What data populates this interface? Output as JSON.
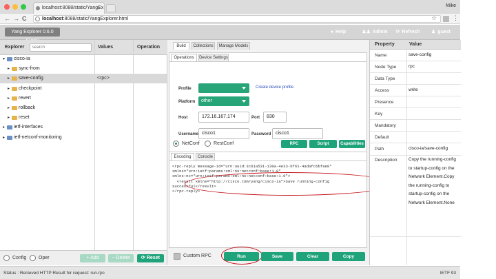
{
  "browser": {
    "tab_title": "localhost:8088/static/YangEx",
    "tab_close": "×",
    "profile": "Mike",
    "url_bold": "localhost",
    "url_rest": ":8088/static/YangExplorer.html",
    "back_glyph": "←",
    "forward_glyph": "→",
    "reload_glyph": "C",
    "star_glyph": "☆",
    "menu_glyph": "⋮"
  },
  "header": {
    "title": "Yang Explorer 0.6.0 (Beta)",
    "buttons": [
      {
        "label": "Help",
        "icon": "github-icon",
        "glyph": "●",
        "color": "#2f8fd8"
      },
      {
        "label": "Admin",
        "icon": "users-icon",
        "glyph": "♟♟",
        "color": "#2f8fd8"
      },
      {
        "label": "Refresh",
        "icon": "refresh-icon",
        "glyph": "⟳",
        "color": "#2f8fd8"
      },
      {
        "label": "guest",
        "icon": "user-icon",
        "glyph": "♟",
        "color": "#1fa37a"
      }
    ]
  },
  "explorer": {
    "col_explorer": "Explorer",
    "search_placeholder": "search",
    "col_values": "Values",
    "col_operation": "Operation",
    "rows": [
      {
        "label": "cisco-ia",
        "type": "module",
        "level": 0,
        "expanded": true,
        "value": ""
      },
      {
        "label": "sync-from",
        "type": "folder",
        "level": 1,
        "expanded": false,
        "value": ""
      },
      {
        "label": "save-config",
        "type": "folder",
        "level": 1,
        "expanded": false,
        "value": "<rpc>",
        "selected": true
      },
      {
        "label": "checkpoint",
        "type": "folder",
        "level": 1,
        "expanded": false,
        "value": ""
      },
      {
        "label": "revert",
        "type": "folder",
        "level": 1,
        "expanded": false,
        "value": ""
      },
      {
        "label": "rollback",
        "type": "folder",
        "level": 1,
        "expanded": false,
        "value": ""
      },
      {
        "label": "reset",
        "type": "folder",
        "level": 1,
        "expanded": false,
        "value": ""
      },
      {
        "label": "ietf-interfaces",
        "type": "module",
        "level": 0,
        "expanded": false,
        "value": ""
      },
      {
        "label": "ietf-netconf-monitoring",
        "type": "module",
        "level": 0,
        "expanded": false,
        "value": ""
      }
    ],
    "footer": {
      "config_label": "Config",
      "oper_label": "Oper",
      "add_label": "+ Add",
      "delete_label": "− Delete",
      "reset_label": "⟳ Reset"
    }
  },
  "middle": {
    "tabs": [
      "Build",
      "Collections",
      "Manage Models"
    ],
    "active_tab": 0,
    "subtabs": [
      "Operations",
      "Device Settings"
    ],
    "form": {
      "profile_label": "Profile",
      "profile_value": "",
      "create_profile_link": "Create device profile",
      "platform_label": "Platform",
      "platform_value": "other",
      "host_label": "Host",
      "host_value": "172.16.167.174",
      "port_label": "Port",
      "port_value": "830",
      "username_label": "Username",
      "username_value": "cisco1",
      "password_label": "Password",
      "password_value": "cisco1",
      "netconf_label": "NetConf",
      "restconf_label": "RestConf",
      "rpc_button": "RPC",
      "script_button": "Script",
      "capabilities_button": "Capabilities"
    },
    "encoding_tabs": [
      "Encoding",
      "Console"
    ],
    "rpc_output": "<rpc-reply message-id=\"urn:uuid:3c61a531-130a-4e33-bf61-4adafc6bfae8\"\nxmlns=\"urn:ietf:params:xml:ns:netconf:base:1.0\"\nxmlns:nc=\"urn:ietf:params:xml:ns:netconf:base:1.0\">\n  <result xmlns=\"http://cisco.com/yang/cisco-ia\">Save running-config\nsuccessful</result>\n</rpc-reply>",
    "footer": {
      "custom_rpc": "Custom RPC",
      "run": "Run",
      "save": "Save",
      "clear": "Clear",
      "copy": "Copy"
    }
  },
  "properties": {
    "col_property": "Property",
    "col_value": "Value",
    "rows": [
      {
        "key": "Name",
        "value": "save-config"
      },
      {
        "key": "Node Type",
        "value": "rpc"
      },
      {
        "key": "Data Type",
        "value": ""
      },
      {
        "key": "Access",
        "value": "write"
      },
      {
        "key": "Presence",
        "value": ""
      },
      {
        "key": "Key",
        "value": ""
      },
      {
        "key": "Mandatory",
        "value": ""
      },
      {
        "key": "Default",
        "value": ""
      },
      {
        "key": "Path",
        "value": "cisco-ia/save-config"
      },
      {
        "key": "Description",
        "value": "Copy the running-config to startup-config on the Network Element.Copy the running-config to startup-config on the Network Element.None"
      }
    ]
  },
  "status": {
    "text": "Status : Recieved HTTP Result for request: run-rpc",
    "ietf": "IETF 93"
  },
  "colors": {
    "green": "#1fa37a",
    "blue": "#2f8fd8",
    "annotation_red": "#c4161c"
  }
}
